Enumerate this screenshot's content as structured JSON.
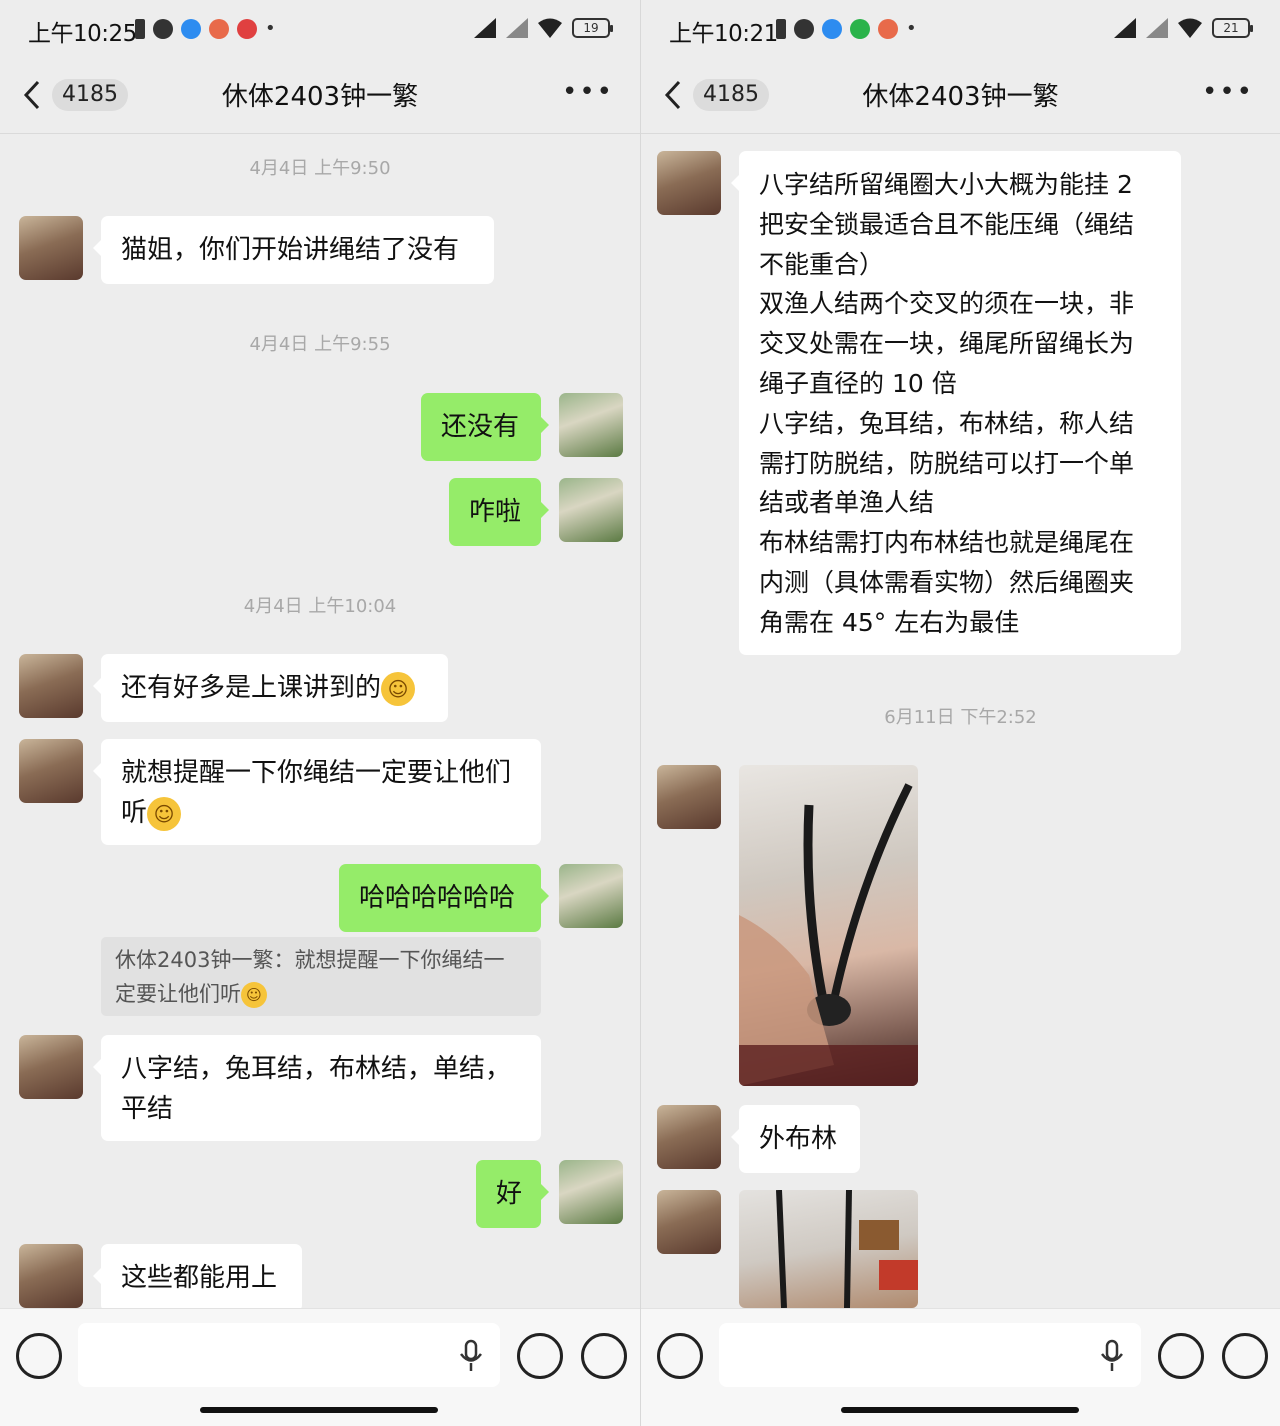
{
  "left": {
    "status": {
      "time": "上午10:25",
      "battery": "19"
    },
    "header": {
      "back_count": "4185",
      "title": "休体2403钟一繁"
    },
    "timestamps": [
      "4月4日 上午9:50",
      "4月4日 上午9:55",
      "4月4日 上午10:04"
    ],
    "messages": {
      "m1": "猫姐，你们开始讲绳结了没有",
      "m2": "还没有",
      "m3": "咋啦",
      "m4": "还有好多是上课讲到的",
      "m5a": "就想提醒一下你绳结一定要让他们",
      "m5b": "听",
      "m6": "哈哈哈哈哈哈",
      "quote_a": "休体2403钟一繁：就想提醒一下你绳结一",
      "quote_b": "定要让他们听",
      "m7a": "八字结，兔耳结，布林结，单结，",
      "m7b": "平结",
      "m8": "好",
      "m9": "这些都能用上"
    }
  },
  "right": {
    "status": {
      "time": "上午10:21",
      "battery": "21"
    },
    "header": {
      "back_count": "4185",
      "title": "休体2403钟一繁"
    },
    "long_message": [
      "八字结所留绳圈大小大概为能挂 2",
      "把安全锁最适合且不能压绳（绳结",
      "不能重合）",
      "双渔人结两个交叉的须在一块，非",
      "交叉处需在一块，绳尾所留绳长为",
      "绳子直径的 10 倍",
      "八字结，兔耳结，布林结，称人结",
      "需打防脱结，防脱结可以打一个单",
      "结或者单渔人结",
      "布林结需打内布林结也就是绳尾在",
      "内测（具体需看实物）然后绳圈夹",
      "角需在 45° 左右为最佳"
    ],
    "timestamp": "6月11日 下午2:52",
    "message_short": "外布林"
  },
  "icons": {
    "back": "chevron-left-icon",
    "more": "ellipsis-icon",
    "voice": "voice-icon",
    "mic": "mic-icon",
    "emoji": "emoji-icon",
    "plus": "plus-icon",
    "emoji_grin": "grinning-emoji",
    "emoji_laugh": "laughing-crying-emoji"
  },
  "colors": {
    "my_bubble": "#95ec69",
    "their_bubble": "#ffffff",
    "background": "#ededed"
  }
}
